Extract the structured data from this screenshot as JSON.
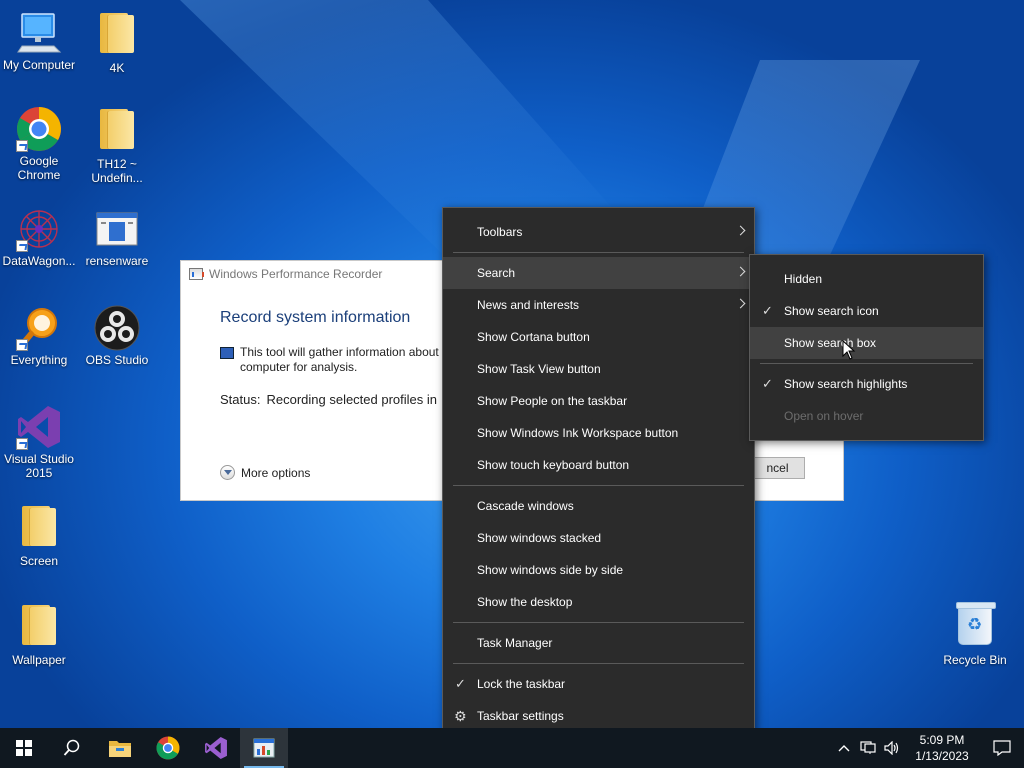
{
  "desktop": {
    "icons": [
      {
        "label": "My Computer"
      },
      {
        "label": "4K"
      },
      {
        "label": "Google Chrome"
      },
      {
        "label": "TH12 ~ Undefin..."
      },
      {
        "label": "DataWagon..."
      },
      {
        "label": "rensenware"
      },
      {
        "label": "Everything"
      },
      {
        "label": "OBS Studio"
      },
      {
        "label": "Visual Studio 2015"
      },
      {
        "label": "Screen"
      },
      {
        "label": "Wallpaper"
      },
      {
        "label": "Recycle Bin"
      }
    ]
  },
  "wpr_window": {
    "title": "Windows Performance Recorder",
    "heading": "Record system information",
    "description": "This tool will gather information about computer for analysis.",
    "status_label": "Status:",
    "status_value": "Recording selected profiles in",
    "more_options": "More options",
    "cancel_label": "ncel"
  },
  "context_menu": {
    "items": [
      {
        "label": "Toolbars"
      },
      {
        "label": "Search"
      },
      {
        "label": "News and interests"
      },
      {
        "label": "Show Cortana button"
      },
      {
        "label": "Show Task View button"
      },
      {
        "label": "Show People on the taskbar"
      },
      {
        "label": "Show Windows Ink Workspace button"
      },
      {
        "label": "Show touch keyboard button"
      },
      {
        "label": "Cascade windows"
      },
      {
        "label": "Show windows stacked"
      },
      {
        "label": "Show windows side by side"
      },
      {
        "label": "Show the desktop"
      },
      {
        "label": "Task Manager"
      },
      {
        "label": "Lock the taskbar"
      },
      {
        "label": "Taskbar settings"
      }
    ]
  },
  "search_submenu": {
    "items": [
      {
        "label": "Hidden"
      },
      {
        "label": "Show search icon"
      },
      {
        "label": "Show search box"
      },
      {
        "label": "Show search highlights"
      },
      {
        "label": "Open on hover"
      }
    ]
  },
  "taskbar": {
    "time": "5:09 PM",
    "date": "1/13/2023"
  },
  "colors": {
    "accent": "#76b9ed",
    "menu_bg": "#2b2b2b",
    "menu_hover": "#414141",
    "taskbar_bg": "#101820",
    "disabled_text": "#6d6d6d"
  }
}
